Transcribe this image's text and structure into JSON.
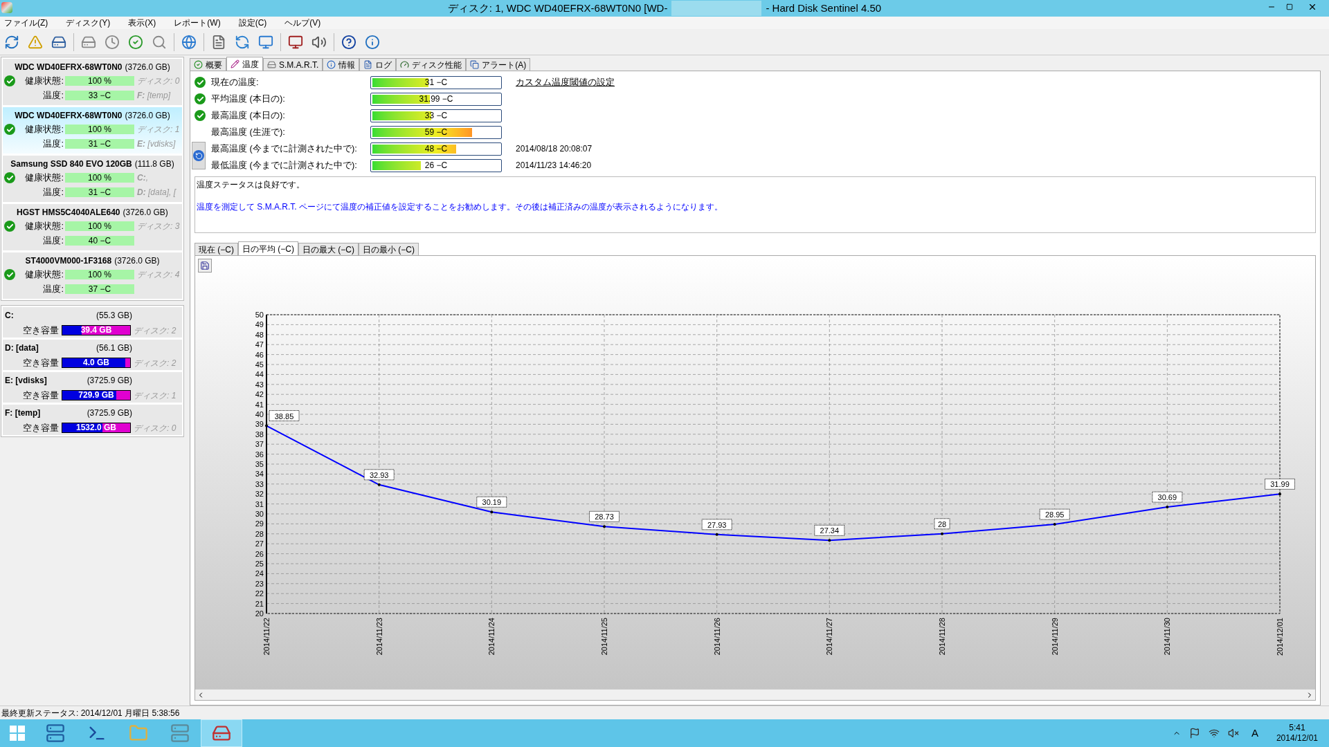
{
  "window": {
    "title_start": "ディスク: 1, WDC WD40EFRX-68WT0N0 [WD-",
    "title_end": "- Hard Disk Sentinel 4.50"
  },
  "menu": [
    "ファイル(Z)",
    "ディスク(Y)",
    "表示(X)",
    "レポート(W)",
    "設定(C)",
    "ヘルプ(V)"
  ],
  "disks": [
    {
      "name": "WDC WD40EFRX-68WT0N0",
      "size": "(3726.0 GB)",
      "selected": false,
      "health_label": "健康状態:",
      "health": "100 %",
      "temp_label": "温度:",
      "temp": "33 −C",
      "note_1": "ディスク: 0",
      "note_2": "**F:** [temp]"
    },
    {
      "name": "WDC WD40EFRX-68WT0N0",
      "size": "(3726.0 GB)",
      "selected": true,
      "health_label": "健康状態:",
      "health": "100 %",
      "temp_label": "温度:",
      "temp": "31 −C",
      "note_1": "ディスク: 1",
      "note_2": "**E:** [vdisks]"
    },
    {
      "name": "Samsung SSD 840 EVO 120GB",
      "size": "(111.8 GB)",
      "selected": false,
      "health_label": "健康状態:",
      "health": "100 %",
      "temp_label": "温度:",
      "temp": "31 −C",
      "note_1": "**C:**,",
      "note_2": "**D:** [data],  ["
    },
    {
      "name": "HGST HMS5C4040ALE640",
      "size": "(3726.0 GB)",
      "selected": false,
      "health_label": "健康状態:",
      "health": "100 %",
      "temp_label": "温度:",
      "temp": "40 −C",
      "note_1": "ディスク: 3"
    },
    {
      "name": "ST4000VM000-1F3168",
      "size": "(3726.0 GB)",
      "selected": false,
      "health_label": "健康状態:",
      "health": "100 %",
      "temp_label": "温度:",
      "temp": "37 −C",
      "note_1": "ディスク: 4"
    }
  ],
  "volumes": [
    {
      "name": "C:",
      "size": "(55.3 GB)",
      "label": "空き容量",
      "free": "39.4 GB",
      "level": 0.29,
      "disk": "ディスク: 2"
    },
    {
      "name": "D: [data]",
      "size": "(56.1 GB)",
      "label": "空き容量",
      "free": "4.0 GB",
      "level": 0.93,
      "disk": "ディスク: 2"
    },
    {
      "name": "E: [vdisks]",
      "size": "(3725.9 GB)",
      "label": "空き容量",
      "free": "729.9 GB",
      "level": 0.8,
      "disk": "ディスク: 1"
    },
    {
      "name": "F: [temp]",
      "size": "(3725.9 GB)",
      "label": "空き容量",
      "free": "1532.0 GB",
      "level": 0.59,
      "disk": "ディスク: 0"
    }
  ],
  "tabs": [
    {
      "label": "概要",
      "kind": "check",
      "selected": false
    },
    {
      "label": "温度",
      "kind": "pencil",
      "selected": true
    },
    {
      "label": "S.M.A.R.T.",
      "kind": "drive",
      "selected": false
    },
    {
      "label": "情報",
      "kind": "info",
      "selected": false
    },
    {
      "label": "ログ",
      "kind": "doc",
      "selected": false
    },
    {
      "label": "ディスク性能",
      "kind": "gauge",
      "selected": false
    },
    {
      "label": "アラート(A)",
      "kind": "copy",
      "selected": false
    }
  ],
  "temperatures": [
    {
      "label": "現在の温度:",
      "ok": true,
      "value": "31 −C",
      "level": 0.44
    },
    {
      "label": "平均温度 (本日の):",
      "ok": true,
      "value": "31.99 −C",
      "level": 0.45
    },
    {
      "label": "最高温度 (本日の):",
      "ok": true,
      "value": "33 −C",
      "level": 0.46
    },
    {
      "label": "最高温度 (生涯で):",
      "ok": false,
      "value": "59 −C",
      "level": 0.78
    },
    {
      "label": "最高温度 (今までに計測された中で):",
      "value": "48 −C",
      "level": 0.66,
      "date": "2014/08/18 20:08:07"
    },
    {
      "label": "最低温度 (今までに計測された中で):",
      "value": "26 −C",
      "level": 0.38,
      "date": "2014/11/23 14:46:20"
    }
  ],
  "threshold_link": "カスタム温度閾値の設定",
  "message": {
    "status": "温度ステータスは良好です。",
    "advice": "温度を測定して S.M.A.R.T. ページにて温度の補正値を設定することをお勧めします。その後は補正済みの温度が表示されるようになります。"
  },
  "chart_tabs": [
    {
      "label": "現在 (−C)",
      "selected": false
    },
    {
      "label": "日の平均 (−C)",
      "selected": true
    },
    {
      "label": "日の最大 (−C)",
      "selected": false
    },
    {
      "label": "日の最小 (−C)",
      "selected": false
    }
  ],
  "chart_data": {
    "type": "line",
    "categories": [
      "2014/11/22",
      "2014/11/23",
      "2014/11/24",
      "2014/11/25",
      "2014/11/26",
      "2014/11/27",
      "2014/11/28",
      "2014/11/29",
      "2014/11/30",
      "2014/12/01"
    ],
    "series": [
      {
        "color": "#0000ff",
        "values": [
          38.85,
          32.93,
          30.19,
          28.73,
          27.93,
          27.34,
          28,
          28.95,
          30.69,
          31.99
        ]
      }
    ],
    "grid": true,
    "ylim": [
      20,
      50
    ],
    "yticks": [
      20,
      21,
      22,
      23,
      24,
      25,
      26,
      27,
      28,
      29,
      30,
      31,
      32,
      33,
      34,
      35,
      36,
      37,
      38,
      39,
      40,
      41,
      42,
      43,
      44,
      45,
      46,
      47,
      48,
      49,
      50
    ],
    "data_labels": true
  },
  "status_bar": "最終更新ステータス: 2014/12/01 月曜日 5:38:56",
  "taskbar": {
    "ime": "A",
    "time": "5:41",
    "date": "2014/12/01"
  }
}
